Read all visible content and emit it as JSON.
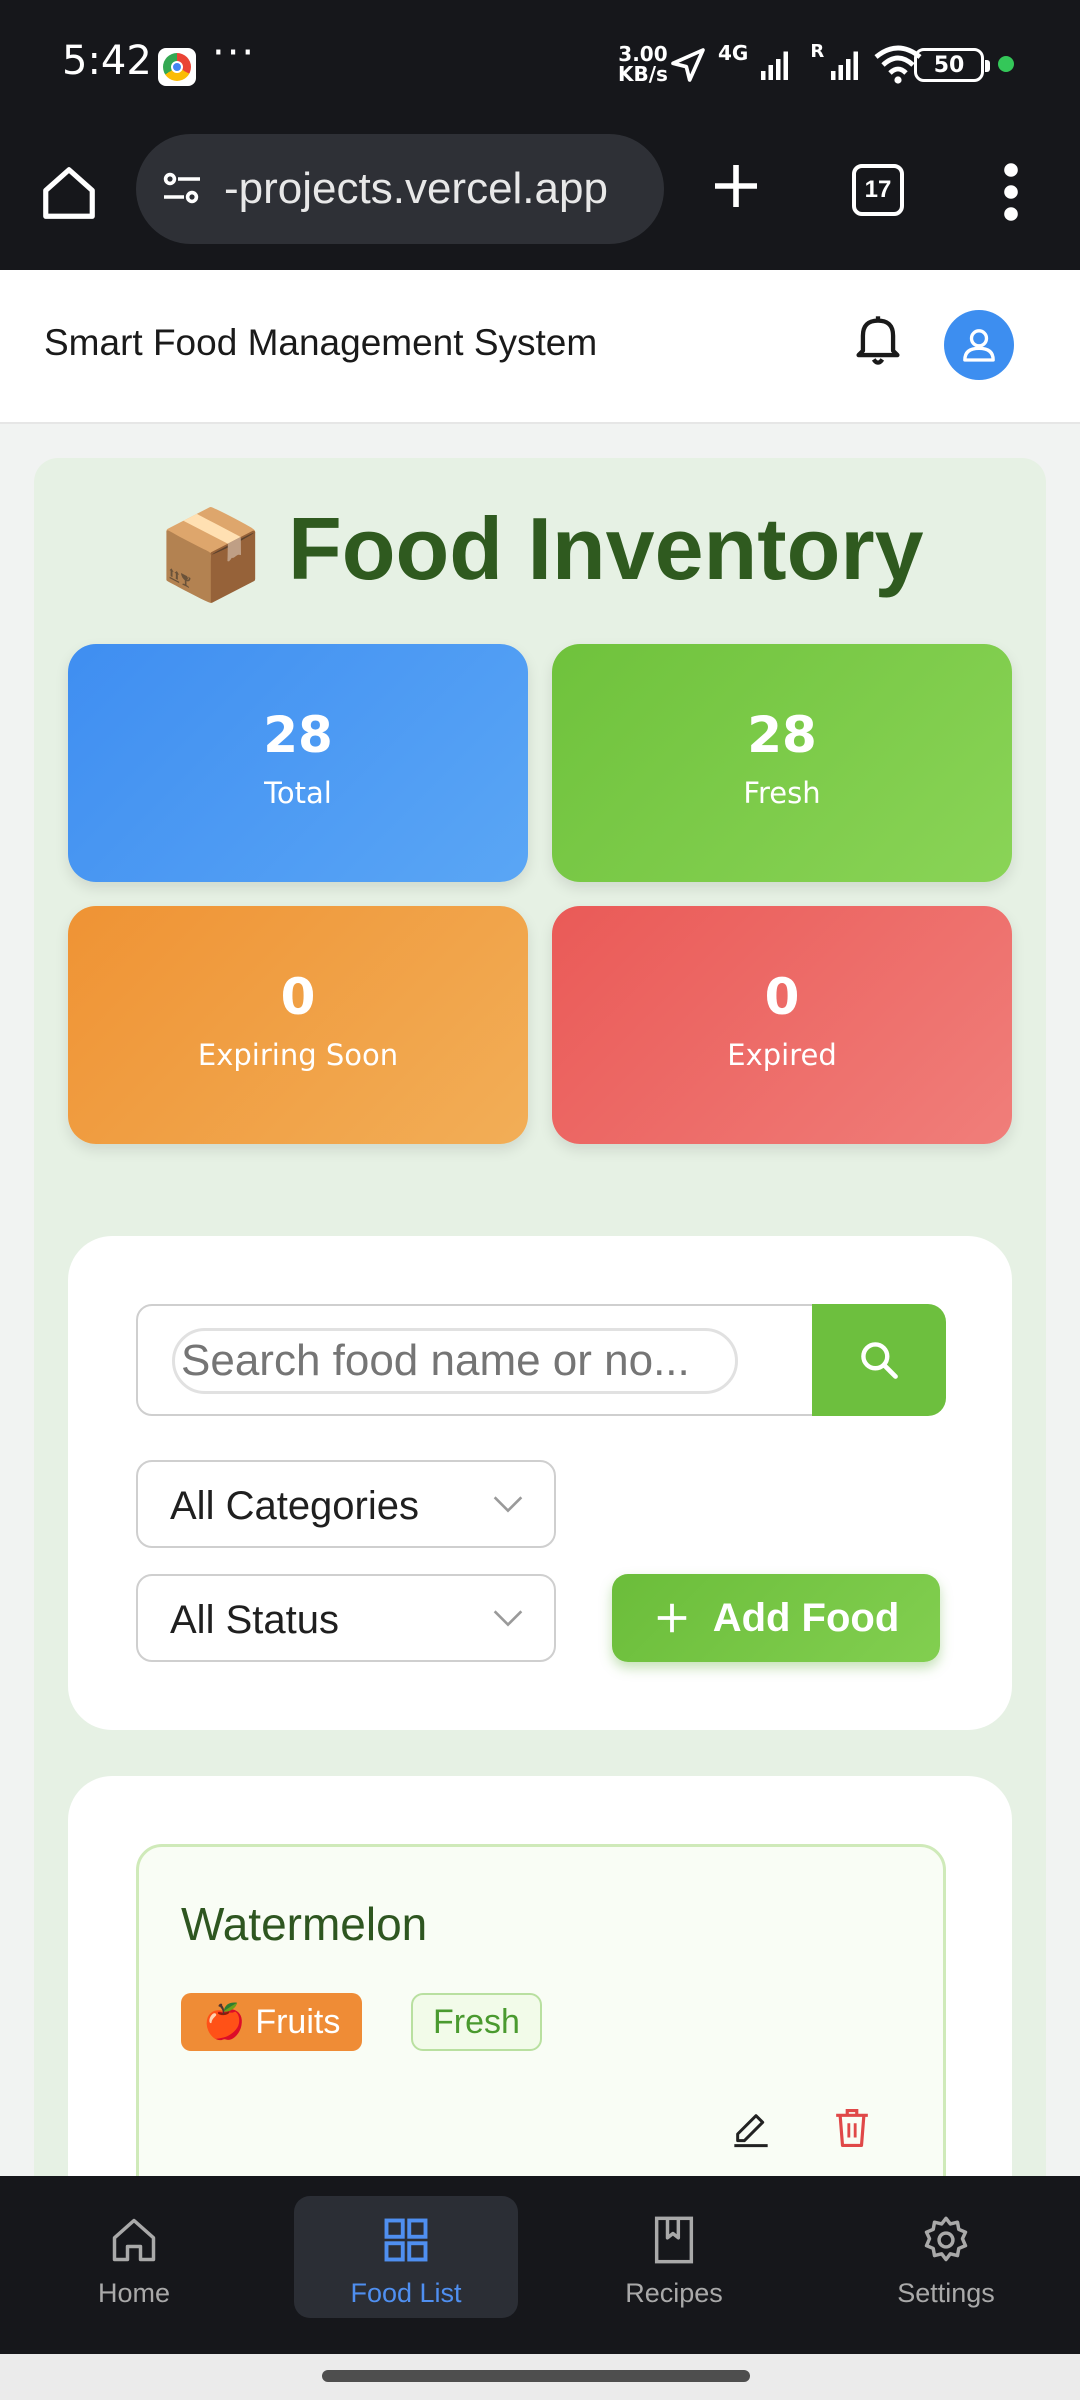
{
  "status_bar": {
    "time": "5:42",
    "more": "···",
    "speed_value": "3.00",
    "speed_unit": "KB/s",
    "network": "4G",
    "roaming": "R",
    "battery": "50"
  },
  "browser": {
    "url": "-projects.vercel.app",
    "tab_count": "17"
  },
  "header": {
    "title": "Smart Food Management System"
  },
  "inventory": {
    "title": "Food Inventory",
    "title_emoji": "📦",
    "stats": {
      "total": {
        "value": "28",
        "label": "Total",
        "color": "#3f8ef1"
      },
      "fresh": {
        "value": "28",
        "label": "Fresh",
        "color": "#6fc23c"
      },
      "expiring_soon": {
        "value": "0",
        "label": "Expiring Soon",
        "color": "#ef9334"
      },
      "expired": {
        "value": "0",
        "label": "Expired",
        "color": "#ea5a57"
      }
    }
  },
  "filters": {
    "search_placeholder": "Search food name or no...",
    "category_value": "All Categories",
    "status_value": "All Status",
    "add_button_label": "Add Food"
  },
  "food_items": [
    {
      "name": "Watermelon",
      "category": "Fruits",
      "category_emoji": "🍎",
      "status": "Fresh"
    }
  ],
  "bottom_nav": {
    "items": [
      {
        "label": "Home",
        "icon": "home-icon"
      },
      {
        "label": "Food List",
        "icon": "grid-icon",
        "active": true
      },
      {
        "label": "Recipes",
        "icon": "book-icon"
      },
      {
        "label": "Settings",
        "icon": "gear-icon"
      }
    ]
  },
  "colors": {
    "accent_green": "#6dbf3e",
    "title_green": "#2f5a1f",
    "active_nav": "#4f8ff0"
  }
}
